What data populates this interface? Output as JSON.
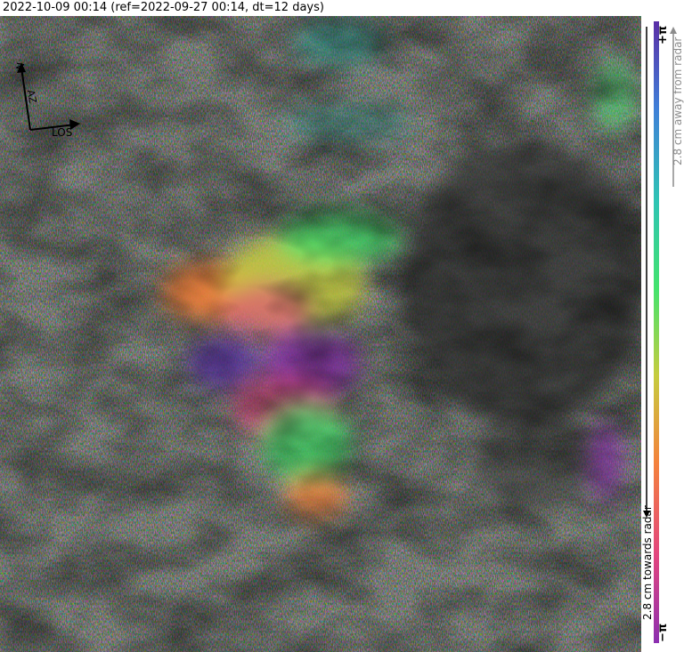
{
  "title": "2022-10-09 00:14 (ref=2022-09-27 00:14, dt=12 days)",
  "compass": {
    "north_label": "N",
    "azimuth_label": "AZ",
    "los_label": "LOS"
  },
  "colorbar": {
    "top_label": "+π",
    "bottom_label": "−π",
    "away_label": "2.8 cm away from radar",
    "towards_label": "2.8 cm towards radar",
    "colors": [
      "#5a2ea6",
      "#3f7fd8",
      "#2ec4b4",
      "#43e36d",
      "#c6cc3e",
      "#f4823c",
      "#e2457f",
      "#8b2fb0"
    ]
  }
}
